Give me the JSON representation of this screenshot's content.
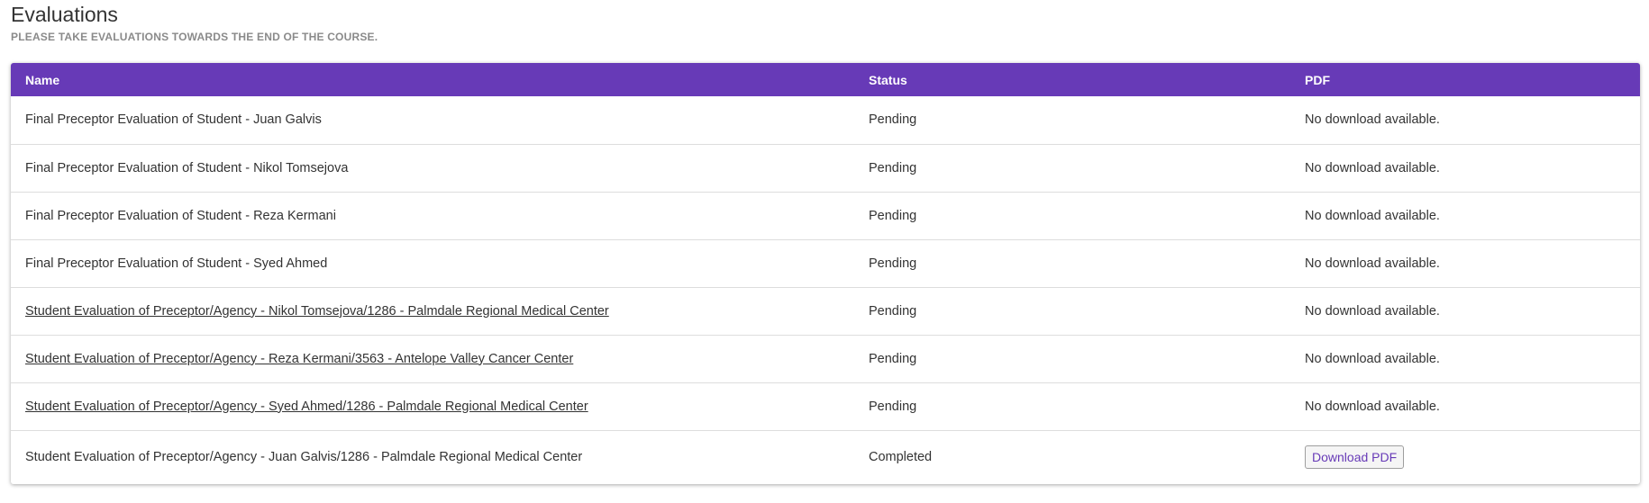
{
  "header": {
    "title": "Evaluations",
    "subtitle": "PLEASE TAKE EVALUATIONS TOWARDS THE END OF THE COURSE."
  },
  "table": {
    "columns": [
      "Name",
      "Status",
      "PDF"
    ],
    "rows": [
      {
        "name": "Final Preceptor Evaluation of Student - Juan Galvis",
        "link": false,
        "status": "Pending",
        "pdf": "No download available.",
        "pdf_button": false
      },
      {
        "name": "Final Preceptor Evaluation of Student - Nikol Tomsejova",
        "link": false,
        "status": "Pending",
        "pdf": "No download available.",
        "pdf_button": false
      },
      {
        "name": "Final Preceptor Evaluation of Student - Reza Kermani",
        "link": false,
        "status": "Pending",
        "pdf": "No download available.",
        "pdf_button": false
      },
      {
        "name": "Final Preceptor Evaluation of Student - Syed Ahmed",
        "link": false,
        "status": "Pending",
        "pdf": "No download available.",
        "pdf_button": false
      },
      {
        "name": "Student Evaluation of Preceptor/Agency - Nikol Tomsejova/1286 - Palmdale Regional Medical Center",
        "link": true,
        "status": "Pending",
        "pdf": "No download available.",
        "pdf_button": false
      },
      {
        "name": "Student Evaluation of Preceptor/Agency - Reza Kermani/3563 - Antelope Valley Cancer Center",
        "link": true,
        "status": "Pending",
        "pdf": "No download available.",
        "pdf_button": false
      },
      {
        "name": "Student Evaluation of Preceptor/Agency - Syed Ahmed/1286 - Palmdale Regional Medical Center",
        "link": true,
        "status": "Pending",
        "pdf": "No download available.",
        "pdf_button": false
      },
      {
        "name": "Student Evaluation of Preceptor/Agency - Juan Galvis/1286 - Palmdale Regional Medical Center",
        "link": false,
        "status": "Completed",
        "pdf": "Download PDF",
        "pdf_button": true
      }
    ]
  },
  "colors": {
    "header_bg": "#673ab7",
    "header_text": "#ffffff",
    "accent": "#673ab7",
    "subtitle": "#8a8a8a"
  }
}
